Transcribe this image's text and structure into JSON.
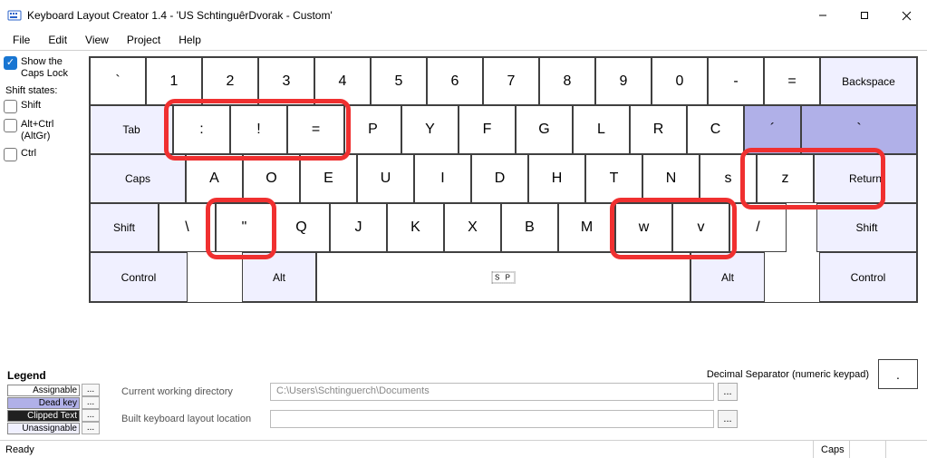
{
  "title": "Keyboard Layout Creator 1.4 - 'US SchtinguêrDvorak - Custom'",
  "menu": {
    "file": "File",
    "edit": "Edit",
    "view": "View",
    "project": "Project",
    "help": "Help"
  },
  "leftpanel": {
    "show_caps": "Show the\nCaps Lock",
    "shift_states": "Shift states:",
    "shift": "Shift",
    "altgr": "Alt+Ctrl\n(AltGr)",
    "ctrl": "Ctrl"
  },
  "keys": {
    "row1": [
      "`",
      "1",
      "2",
      "3",
      "4",
      "5",
      "6",
      "7",
      "8",
      "9",
      "0",
      "-",
      "="
    ],
    "backspace": "Backspace",
    "tab": "Tab",
    "row2": [
      ":",
      "!",
      "=",
      "P",
      "Y",
      "F",
      "G",
      "L",
      "R",
      "C",
      "´",
      "`"
    ],
    "caps": "Caps",
    "row3": [
      "A",
      "O",
      "E",
      "U",
      "I",
      "D",
      "H",
      "T",
      "N",
      "s",
      "z"
    ],
    "return": "Return",
    "shift": "Shift",
    "row4": [
      "\\",
      "\"",
      "Q",
      "J",
      "K",
      "X",
      "B",
      "M",
      "w",
      "v",
      "/"
    ],
    "control": "Control",
    "alt": "Alt",
    "sp": "S P"
  },
  "dec_sep_label": "Decimal Separator (numeric keypad)",
  "dec_sep_value": ".",
  "legend": {
    "title": "Legend",
    "assignable": "Assignable",
    "deadkey": "Dead key",
    "clipped": "Clipped Text",
    "unassignable": "Unassignable"
  },
  "form": {
    "cwd_label": "Current working directory",
    "cwd_value": "C:\\Users\\Schtinguerch\\Documents",
    "loc_label": "Built keyboard layout location",
    "loc_value": ""
  },
  "status": {
    "ready": "Ready",
    "caps": "Caps"
  },
  "winbtn": {
    "min": "—",
    "max": "☐",
    "close": "✕"
  }
}
